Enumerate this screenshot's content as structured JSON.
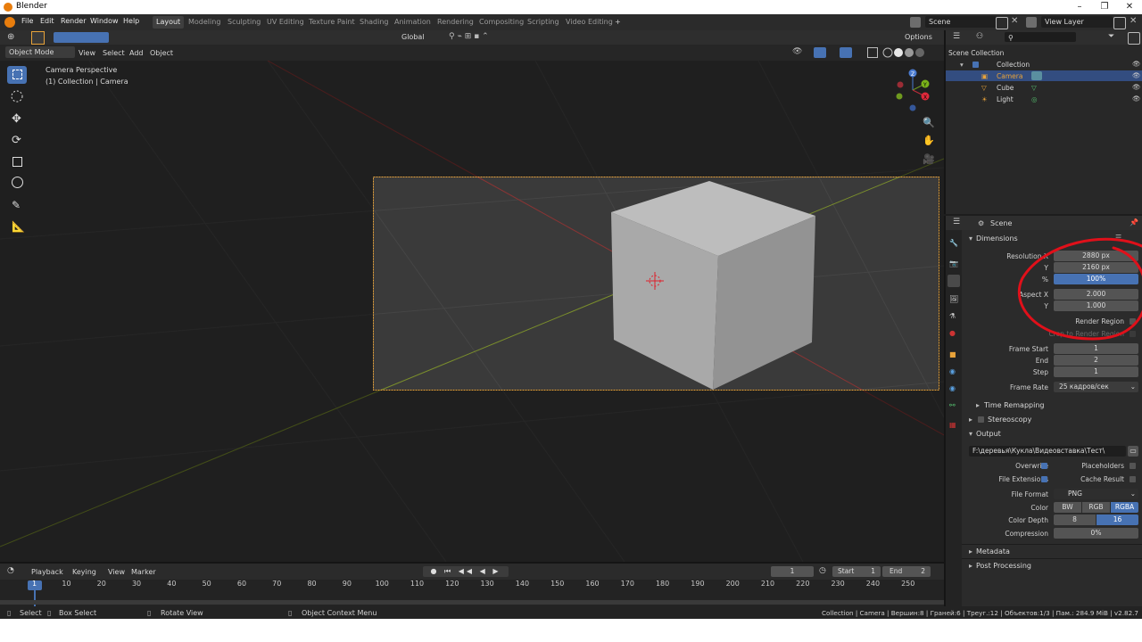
{
  "window": {
    "title": "Blender",
    "controls": [
      "–",
      "❐",
      "✕"
    ]
  },
  "menu": [
    "File",
    "Edit",
    "Render",
    "Window",
    "Help"
  ],
  "workspaces": [
    "Layout",
    "Modeling",
    "Sculpting",
    "UV Editing",
    "Texture Paint",
    "Shading",
    "Animation",
    "Rendering",
    "Compositing",
    "Scripting",
    "Video Editing"
  ],
  "workspace_add": "+",
  "scene_field": "Scene",
  "view_layer_field": "View Layer",
  "viewport": {
    "transform_orientation": "Global",
    "options_label": "Options",
    "mode": "Object Mode",
    "header_menus": [
      "View",
      "Select",
      "Add",
      "Object"
    ],
    "overlay_title": "Camera Perspective",
    "overlay_sub": "(1) Collection | Camera",
    "gizmo_labels": {
      "z": "Z",
      "y": "Y",
      "x": "X"
    }
  },
  "outliner": {
    "root": "Scene Collection",
    "collection": "Collection",
    "items": [
      "Camera",
      "Cube",
      "Light"
    ]
  },
  "properties": {
    "context": "Scene",
    "dimensions": {
      "title": "Dimensions",
      "res_x_label": "Resolution X",
      "res_x": "2880 px",
      "res_y_label": "Y",
      "res_y": "2160 px",
      "pct_label": "%",
      "pct": "100%",
      "aspect_x_label": "Aspect X",
      "aspect_x": "2.000",
      "aspect_y_label": "Y",
      "aspect_y": "1.000",
      "render_region_label": "Render Region",
      "crop_label": "Crop to Render Region",
      "frame_start_label": "Frame Start",
      "frame_start": "1",
      "end_label": "End",
      "end": "2",
      "step_label": "Step",
      "step": "1",
      "frame_rate_label": "Frame Rate",
      "frame_rate": "25 кадров/сек"
    },
    "time_remapping": "Time Remapping",
    "stereoscopy": "Stereoscopy",
    "output": {
      "title": "Output",
      "path": "F:\\деревья\\Кукла\\Видеовставка\\Тест\\",
      "overwrite_label": "Overwrite",
      "placeholders_label": "Placeholders",
      "file_ext_label": "File Extensions",
      "cache_label": "Cache Result",
      "file_format_label": "File Format",
      "file_format": "PNG",
      "color_label": "Color",
      "color_opts": [
        "BW",
        "RGB",
        "RGBA"
      ],
      "depth_label": "Color Depth",
      "depth_opts": [
        "8",
        "16"
      ],
      "compression_label": "Compression",
      "compression": "0%"
    },
    "metadata": "Metadata",
    "post_processing": "Post Processing"
  },
  "timeline": {
    "menus": [
      "Playback",
      "Keying",
      "View",
      "Marker"
    ],
    "current_frame": "1",
    "start_label": "Start",
    "start": "1",
    "end_label": "End",
    "end": "2",
    "ticks": [
      "1",
      "10",
      "20",
      "30",
      "40",
      "50",
      "60",
      "70",
      "80",
      "90",
      "100",
      "110",
      "120",
      "130",
      "140",
      "150",
      "160",
      "170",
      "180",
      "190",
      "200",
      "210",
      "220",
      "230",
      "240",
      "250"
    ]
  },
  "status": {
    "select": "Select",
    "box_select": "Box Select",
    "rotate_view": "Rotate View",
    "context_menu": "Object Context Menu",
    "stats": "Collection | Camera | Вершин:8 | Граней:6 | Треуг.:12 | Объектов:1/3 | Пам.: 284.9 MiB | v2.82.7"
  },
  "colors": {
    "accent": "#4772b3",
    "selection": "#e8a33a",
    "annotation": "#e0101a"
  }
}
